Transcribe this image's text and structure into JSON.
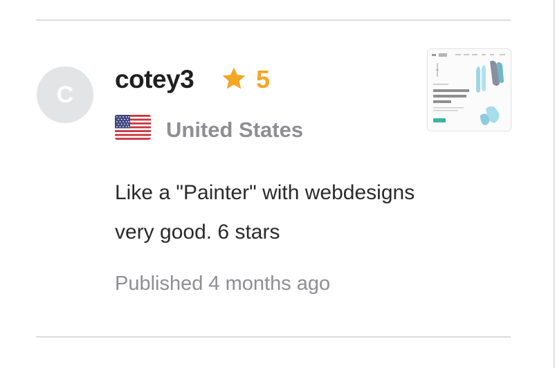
{
  "review": {
    "avatar_initial": "C",
    "reviewer_name": "cotey3",
    "rating": "5",
    "country": "United States",
    "text_line1": "Like a \"Painter\" with webdesigns",
    "text_line2": "very good. 6 stars",
    "published_label": "Published 4 months ago",
    "attachment_icon": "website-screenshot-thumbnail",
    "flag_icon": "us-flag-icon"
  },
  "colors": {
    "star": "#f5a623",
    "name": "#1f1f1f",
    "muted": "#8e8e93",
    "avatar_bg": "#e3e4e6",
    "divider": "#dcdcdc"
  }
}
